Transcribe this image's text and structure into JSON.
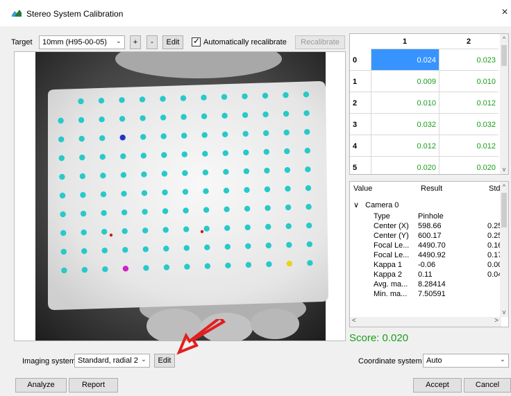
{
  "window": {
    "title": "Stereo System Calibration",
    "close_glyph": "×"
  },
  "toolbar": {
    "target_label": "Target",
    "target_value": "10mm (H95-00-05)",
    "plus_label": "+",
    "minus_label": "-",
    "edit_label": "Edit",
    "auto_recalibrate_label": "Automatically recalibrate",
    "auto_recalibrate_checked": true,
    "recalibrate_label": "Recalibrate"
  },
  "calibration_target": {
    "grid_rows": 10,
    "grid_cols": 13,
    "dot_color": "#27c9c9",
    "markers": [
      {
        "name": "blue-marker",
        "color": "#2233cc"
      },
      {
        "name": "magenta-marker",
        "color": "#d020c8"
      },
      {
        "name": "yellow-marker",
        "color": "#e8d41a"
      },
      {
        "name": "red-marker",
        "color": "#d01818"
      }
    ]
  },
  "residual_table": {
    "columns": [
      "1",
      "2"
    ],
    "rows": [
      {
        "label": "0",
        "values": [
          "0.024",
          "0.023"
        ]
      },
      {
        "label": "1",
        "values": [
          "0.009",
          "0.010"
        ]
      },
      {
        "label": "2",
        "values": [
          "0.010",
          "0.012"
        ]
      },
      {
        "label": "3",
        "values": [
          "0.032",
          "0.032"
        ]
      },
      {
        "label": "4",
        "values": [
          "0.012",
          "0.012"
        ]
      },
      {
        "label": "5",
        "values": [
          "0.020",
          "0.020"
        ]
      }
    ],
    "selected_row": 0,
    "value_color": "#1a9c1a"
  },
  "results_tree": {
    "headers": [
      "Value",
      "Result",
      "StdI"
    ],
    "group": "Camera 0",
    "expand_glyph": "∨",
    "rows": [
      {
        "name": "Type",
        "result": "Pinhole",
        "std": ""
      },
      {
        "name": "Center (X)",
        "result": "598.66",
        "std": "0.25"
      },
      {
        "name": "Center (Y)",
        "result": "600.17",
        "std": "0.25"
      },
      {
        "name": "Focal Le...",
        "result": "4490.70",
        "std": "0.16"
      },
      {
        "name": "Focal Le...",
        "result": "4490.92",
        "std": "0.17"
      },
      {
        "name": "Kappa 1",
        "result": "-0.06",
        "std": "0.00"
      },
      {
        "name": "Kappa 2",
        "result": "0.11",
        "std": "0.04"
      },
      {
        "name": "Avg. ma...",
        "result": "8.28414",
        "std": ""
      },
      {
        "name": "Min. ma...",
        "result": "7.50591",
        "std": ""
      }
    ]
  },
  "score": {
    "text": "Score: 0.020"
  },
  "bottom": {
    "imaging_system_label": "Imaging system",
    "imaging_system_value": "Standard, radial 2",
    "edit_label": "Edit",
    "coordinate_system_label": "Coordinate system",
    "coordinate_system_value": "Auto",
    "analyze_label": "Analyze",
    "report_label": "Report",
    "accept_label": "Accept",
    "cancel_label": "Cancel"
  },
  "colors": {
    "annotation_arrow": "#e02020",
    "selection": "#3794ff",
    "score": "#1a9c1a"
  },
  "scroll_glyphs": {
    "up": "^",
    "down": "v",
    "left": "<",
    "right": ">"
  }
}
